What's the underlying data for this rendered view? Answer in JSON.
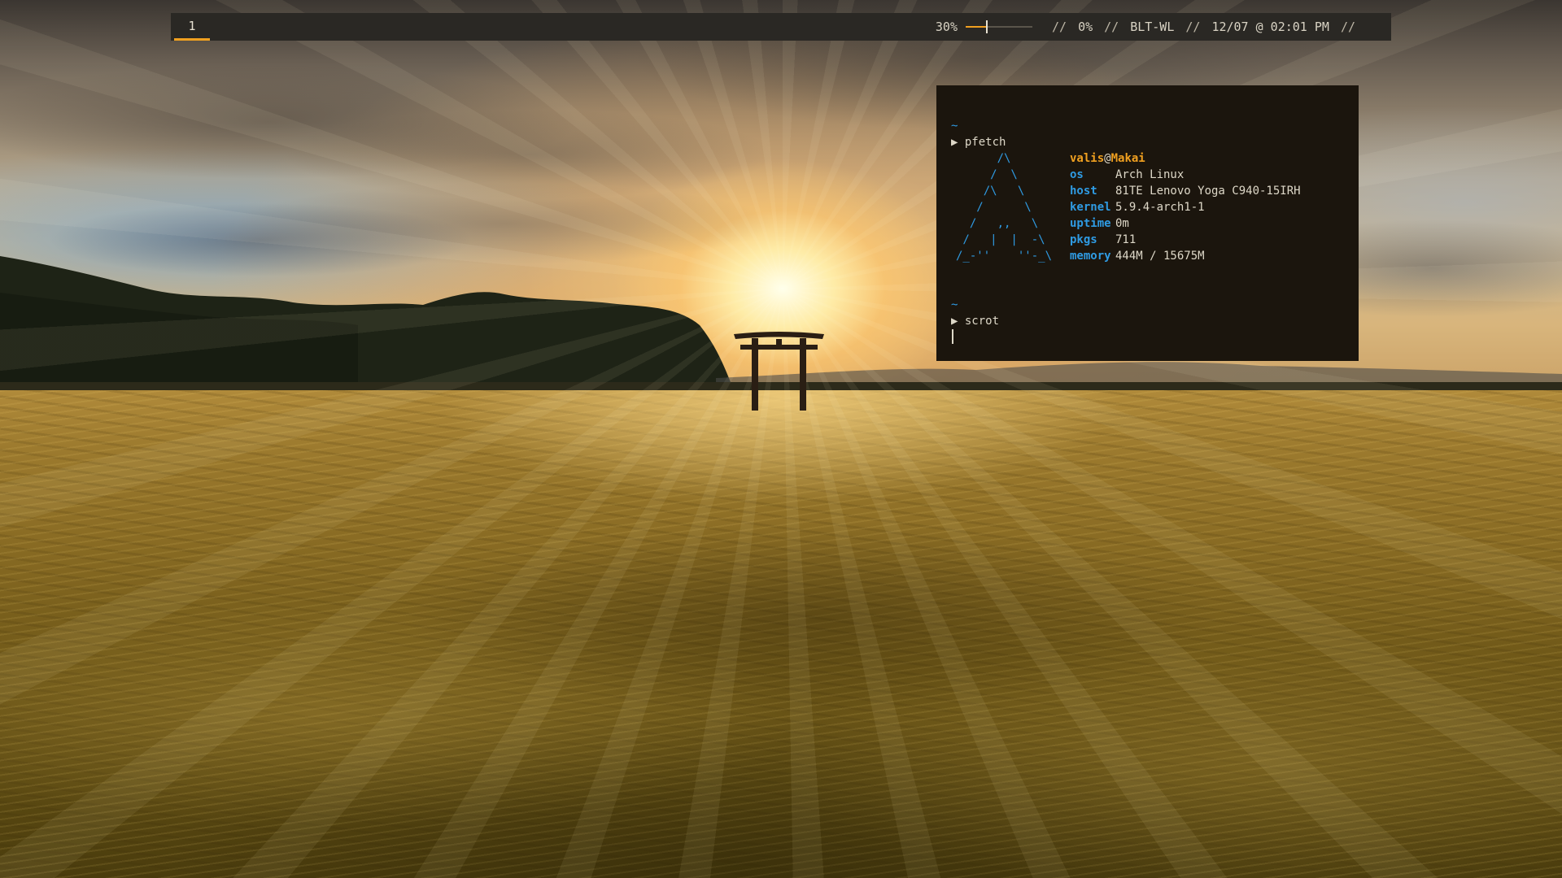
{
  "topbar": {
    "workspace": "1",
    "volume": {
      "label": "30%",
      "level": 0.3
    },
    "sep1": "//",
    "brightness": "0%",
    "sep2": "//",
    "network": "BLT-WL",
    "sep3": "//",
    "datetime": "12/07 @ 02:01 PM",
    "sep4": "//"
  },
  "terminal": {
    "prompt_dir_1": "~",
    "prompt_symbol_1": "▶",
    "command_1": "pfetch",
    "user": "valis",
    "at": "@",
    "host": "Makai",
    "info": [
      {
        "key": "os",
        "value": "Arch Linux"
      },
      {
        "key": "host",
        "value": "81TE Lenovo Yoga C940-15IRH"
      },
      {
        "key": "kernel",
        "value": "5.9.4-arch1-1"
      },
      {
        "key": "uptime",
        "value": "0m"
      },
      {
        "key": "pkgs",
        "value": "711"
      },
      {
        "key": "memory",
        "value": "444M / 15675M"
      }
    ],
    "logo_ascii": "      /\\\n     /  \\\n    /\\   \\\n   /      \\\n  /   ,,   \\\n /   |  |  -\\\n/_-''    ''-_\\",
    "prompt_dir_2": "~",
    "prompt_symbol_2": "▶",
    "command_2": "scrot"
  },
  "colors": {
    "accent": "#f0a020",
    "terminal_blue": "#2f9be3",
    "bar_bg": "#2a2824",
    "terminal_bg": "#1b150d"
  }
}
